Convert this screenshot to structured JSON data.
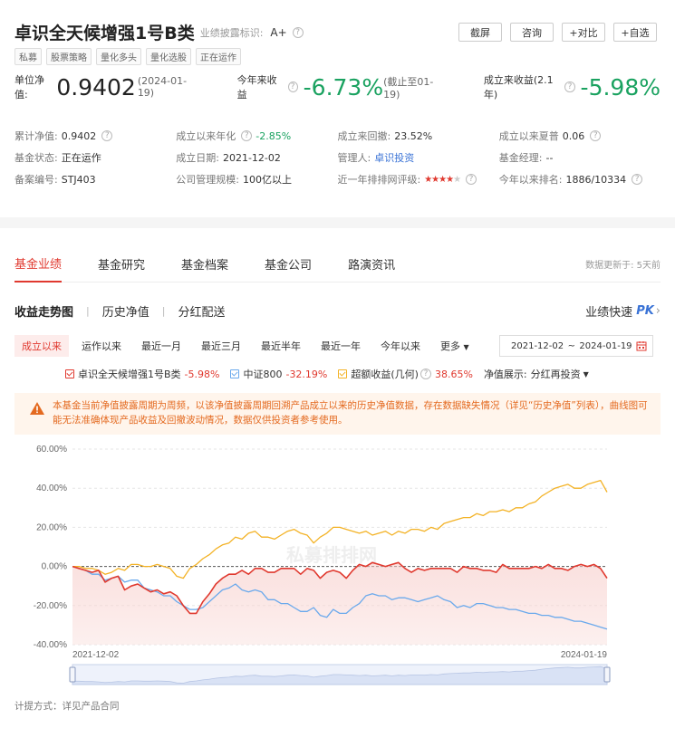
{
  "fund": {
    "name": "卓识全天候增强1号B类",
    "disclosure_label": "业绩披露标识:",
    "disclosure_value": "A+",
    "tags": [
      "私募",
      "股票策略",
      "量化多头",
      "量化选股",
      "正在运作"
    ]
  },
  "buttons": {
    "screenshot": "截屏",
    "consult": "咨询",
    "compare": "+对比",
    "watch": "+自选"
  },
  "nav": {
    "label": "单位净值:",
    "value": "0.9402",
    "date": "(2024-01-19)",
    "ytd_label": "今年来收益",
    "ytd_value": "-6.73%",
    "ytd_note": "(截止至01-19)",
    "since_label": "成立来收益(2.1年)",
    "since_value": "-5.98%"
  },
  "info": [
    [
      {
        "k": "累计净值:",
        "v": "0.9402",
        "q": true
      },
      {
        "k": "成立以来年化",
        "v": "-2.85%",
        "q": true,
        "color": "green"
      },
      {
        "k": "成立来回撤:",
        "v": "23.52%"
      },
      {
        "k": "成立以来夏普",
        "v": "0.06",
        "q": true
      }
    ],
    [
      {
        "k": "基金状态:",
        "v": "正在运作"
      },
      {
        "k": "成立日期:",
        "v": "2021-12-02"
      },
      {
        "k": "管理人:",
        "v": "卓识投资",
        "color": "blue"
      },
      {
        "k": "基金经理:",
        "v": "--"
      }
    ],
    [
      {
        "k": "备案编号:",
        "v": "STJ403"
      },
      {
        "k": "公司管理规模:",
        "v": "100亿以上"
      },
      {
        "k": "近一年排排网评级:",
        "v": "",
        "stars": 4
      },
      {
        "k": "今年以来排名:",
        "v": "1886/10334",
        "q": true
      }
    ]
  ],
  "tabs": [
    "基金业绩",
    "基金研究",
    "基金档案",
    "基金公司",
    "路演资讯"
  ],
  "update_note": "数据更新于: 5天前",
  "subtabs": [
    "收益走势图",
    "历史净值",
    "分红配送"
  ],
  "pk_label": "业绩快速",
  "pk_tag": "PK",
  "ranges": [
    "成立以来",
    "运作以来",
    "最近一月",
    "最近三月",
    "最近半年",
    "最近一年",
    "今年以来",
    "更多"
  ],
  "date_range": {
    "start": "2021-12-02",
    "sep": "~",
    "end": "2024-01-19"
  },
  "legend": [
    {
      "name": "卓识全天候增强1号B类",
      "value": "-5.98%",
      "color": "#e0392f"
    },
    {
      "name": "中证800",
      "value": "-32.19%",
      "color": "#6aa9ec"
    },
    {
      "name": "超额收益(几何)",
      "value": "38.65%",
      "color": "#f3b225"
    }
  ],
  "nav_display_label": "净值展示:",
  "nav_display_value": "分红再投资",
  "warning": "本基金当前净值披露周期为周频，以该净值披露周期回溯产品成立以来的历史净值数据，存在数据缺失情况（详见“历史净值”列表），曲线图可能无法准确体现产品收益及回撤波动情况，数据仅供投资者参考使用。",
  "watermark": "私募排排网",
  "footer": "计提方式：详见产品合同",
  "chart_data": {
    "type": "line",
    "ylim": [
      -40,
      60
    ],
    "y_ticks": [
      "60.00%",
      "40.00%",
      "20.00%",
      "0.00%",
      "-20.00%",
      "-40.00%"
    ],
    "x_ticks": [
      "2021-12-02",
      "2024-01-19"
    ],
    "series": [
      {
        "name": "卓识全天候增强1号B类",
        "color": "#e0392f",
        "values": [
          0,
          -1,
          -2,
          -3,
          -2,
          -8,
          -6,
          -5,
          -12,
          -10,
          -9,
          -11,
          -13,
          -12,
          -14,
          -13,
          -15,
          -20,
          -24,
          -24,
          -18,
          -14,
          -9,
          -6,
          -4,
          -4,
          -2,
          -4,
          -1,
          -1,
          -3,
          -3,
          -1,
          -1,
          -1,
          -4,
          -1,
          -2,
          -6,
          -3,
          -2,
          -3,
          -6,
          -2,
          1,
          0,
          2,
          1,
          0,
          1,
          2,
          -1,
          -3,
          -1,
          -2,
          -1,
          -1,
          -1,
          -1,
          -3,
          0,
          -1,
          -1,
          -2,
          -2,
          -3,
          1,
          -1,
          -1,
          -1,
          -1,
          0,
          -1,
          1,
          -1,
          -1,
          -2,
          0,
          1,
          0,
          1,
          -1,
          -6
        ]
      },
      {
        "name": "中证800",
        "color": "#6aa9ec",
        "values": [
          0,
          -1,
          -2,
          -4,
          -4,
          -7,
          -6,
          -5,
          -8,
          -7,
          -7,
          -11,
          -12,
          -13,
          -15,
          -15,
          -18,
          -20,
          -22,
          -22,
          -21,
          -18,
          -15,
          -12,
          -11,
          -9,
          -12,
          -13,
          -12,
          -13,
          -17,
          -17,
          -19,
          -19,
          -21,
          -23,
          -23,
          -21,
          -25,
          -26,
          -22,
          -24,
          -24,
          -21,
          -19,
          -15,
          -14,
          -15,
          -15,
          -17,
          -16,
          -16,
          -17,
          -18,
          -17,
          -16,
          -15,
          -17,
          -18,
          -21,
          -20,
          -21,
          -19,
          -19,
          -20,
          -21,
          -21,
          -22,
          -22,
          -23,
          -24,
          -24,
          -25,
          -25,
          -26,
          -26,
          -27,
          -28,
          -28,
          -29,
          -30,
          -31,
          -32
        ]
      },
      {
        "name": "超额收益(几何)",
        "color": "#f3b225",
        "values": [
          0,
          0,
          -1,
          -1,
          -2,
          -4,
          -3,
          -1,
          -2,
          1,
          1,
          0,
          0,
          1,
          0,
          -1,
          -5,
          -6,
          -1,
          1,
          4,
          6,
          9,
          11,
          12,
          15,
          14,
          17,
          18,
          15,
          15,
          14,
          16,
          18,
          19,
          17,
          16,
          12,
          15,
          17,
          20,
          20,
          19,
          18,
          17,
          18,
          16,
          17,
          18,
          16,
          18,
          17,
          19,
          19,
          18,
          20,
          19,
          22,
          23,
          24,
          25,
          25,
          27,
          26,
          28,
          28,
          29,
          28,
          30,
          30,
          32,
          33,
          36,
          38,
          40,
          41,
          42,
          40,
          40,
          42,
          43,
          44,
          38
        ]
      }
    ]
  }
}
